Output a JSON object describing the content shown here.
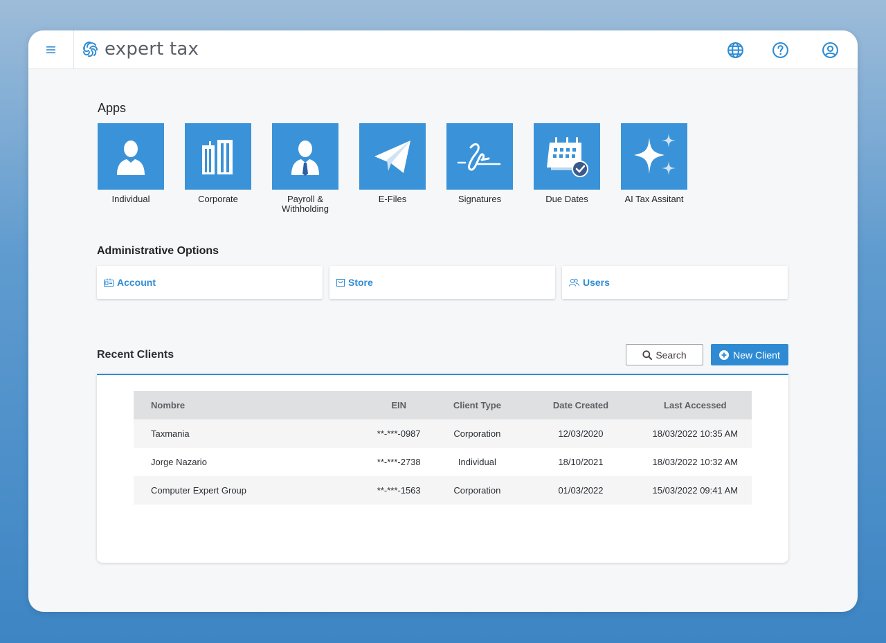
{
  "brand": {
    "name": "expert tax"
  },
  "header": {
    "icons": [
      "menu-icon",
      "globe-icon",
      "help-icon",
      "user-account-icon"
    ]
  },
  "apps": {
    "title": "Apps",
    "items": [
      {
        "label": "Individual",
        "icon": "person-icon"
      },
      {
        "label": "Corporate",
        "icon": "building-icon"
      },
      {
        "label": "Payroll &\nWithholding",
        "icon": "employee-tie-icon"
      },
      {
        "label": "E-Files",
        "icon": "paper-plane-icon"
      },
      {
        "label": "Signatures",
        "icon": "signature-icon"
      },
      {
        "label": "Due Dates",
        "icon": "calendar-check-icon"
      },
      {
        "label": "AI Tax Assitant",
        "icon": "sparkles-icon"
      }
    ]
  },
  "admin": {
    "title": "Administrative Options",
    "items": [
      {
        "label": "Account",
        "icon": "id-card-icon"
      },
      {
        "label": "Store",
        "icon": "bag-icon"
      },
      {
        "label": "Users",
        "icon": "users-icon"
      }
    ]
  },
  "recent": {
    "title": "Recent Clients",
    "search_label": "Search",
    "new_label": "New Client",
    "columns": [
      "Nombre",
      "EIN",
      "Client Type",
      "Date Created",
      "Last Accessed"
    ],
    "rows": [
      [
        "Taxmania",
        "**-***-0987",
        "Corporation",
        "12/03/2020",
        "18/03/2022 10:35 AM"
      ],
      [
        "Jorge Nazario",
        "**-***-2738",
        "Individual",
        "18/10/2021",
        "18/03/2022 10:32 AM"
      ],
      [
        "Computer Expert Group",
        "**-***-1563",
        "Corporation",
        "01/03/2022",
        "15/03/2022 09:41 AM"
      ]
    ]
  },
  "colors": {
    "accent": "#2e8bd3",
    "tile": "#3a93d8"
  }
}
